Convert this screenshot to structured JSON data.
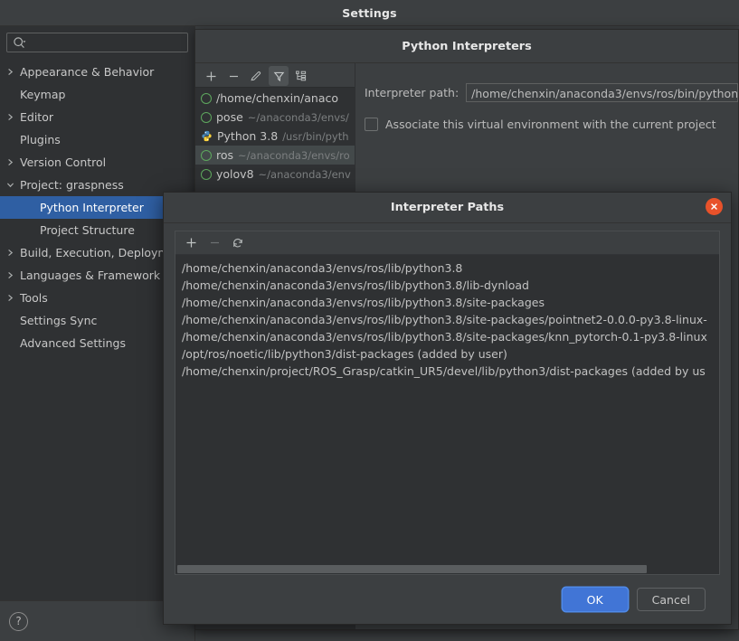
{
  "settings": {
    "title": "Settings",
    "search": {
      "value": "",
      "placeholder": ""
    },
    "tree": [
      {
        "label": "Appearance & Behavior",
        "arrow": "chevron-right",
        "indent": 0,
        "selected": false
      },
      {
        "label": "Keymap",
        "arrow": "none",
        "indent": 0,
        "selected": false
      },
      {
        "label": "Editor",
        "arrow": "chevron-right",
        "indent": 0,
        "selected": false
      },
      {
        "label": "Plugins",
        "arrow": "none",
        "indent": 0,
        "selected": false
      },
      {
        "label": "Version Control",
        "arrow": "chevron-right",
        "indent": 0,
        "selected": false
      },
      {
        "label": "Project: graspness",
        "arrow": "chevron-down",
        "indent": 0,
        "selected": false
      },
      {
        "label": "Python Interpreter",
        "arrow": "none",
        "indent": 1,
        "selected": true
      },
      {
        "label": "Project Structure",
        "arrow": "none",
        "indent": 1,
        "selected": false
      },
      {
        "label": "Build, Execution, Deployn",
        "arrow": "chevron-right",
        "indent": 0,
        "selected": false
      },
      {
        "label": "Languages & Framework",
        "arrow": "chevron-right",
        "indent": 0,
        "selected": false
      },
      {
        "label": "Tools",
        "arrow": "chevron-right",
        "indent": 0,
        "selected": false
      },
      {
        "label": "Settings Sync",
        "arrow": "none",
        "indent": 0,
        "selected": false
      },
      {
        "label": "Advanced Settings",
        "arrow": "none",
        "indent": 0,
        "selected": false
      }
    ],
    "help_glyph": "?"
  },
  "interpreters": {
    "title": "Python Interpreters",
    "toolbar": [
      {
        "name": "add-interpreter-button",
        "icon": "plus-icon",
        "active": false
      },
      {
        "name": "remove-interpreter-button",
        "icon": "minus-icon",
        "active": false
      },
      {
        "name": "edit-interpreter-button",
        "icon": "pencil-icon",
        "active": false
      },
      {
        "name": "filter-interpreters-button",
        "icon": "filter-icon",
        "active": true
      },
      {
        "name": "group-interpreters-button",
        "icon": "tree-structure-icon",
        "active": false
      }
    ],
    "list": [
      {
        "name": "/home/chenxin/anaco",
        "sub": "",
        "icon": "conda-env-icon",
        "selected": false
      },
      {
        "name": "pose",
        "sub": "~/anaconda3/envs/",
        "icon": "conda-env-icon",
        "selected": false
      },
      {
        "name": "Python 3.8",
        "sub": "/usr/bin/pyth",
        "icon": "python-icon",
        "selected": false
      },
      {
        "name": "ros",
        "sub": "~/anaconda3/envs/ro",
        "icon": "conda-env-icon",
        "selected": true
      },
      {
        "name": "yolov8",
        "sub": "~/anaconda3/env",
        "icon": "conda-env-icon",
        "selected": false
      }
    ],
    "detail": {
      "path_label": "Interpreter path:",
      "path_label_mnemonic": "I",
      "path_value": "/home/chenxin/anaconda3/envs/ros/bin/python",
      "associate_checkbox_label": "Associate this virtual environment with the current project",
      "associate_checked": false
    }
  },
  "paths_dialog": {
    "title": "Interpreter Paths",
    "close_icon": "close-icon",
    "toolbar": [
      {
        "name": "add-path-button",
        "icon": "plus-icon",
        "enabled": true
      },
      {
        "name": "remove-path-button",
        "icon": "minus-icon",
        "enabled": false
      },
      {
        "name": "reload-paths-button",
        "icon": "refresh-icon",
        "enabled": true
      }
    ],
    "paths": [
      "/home/chenxin/anaconda3/envs/ros/lib/python3.8",
      "/home/chenxin/anaconda3/envs/ros/lib/python3.8/lib-dynload",
      "/home/chenxin/anaconda3/envs/ros/lib/python3.8/site-packages",
      "/home/chenxin/anaconda3/envs/ros/lib/python3.8/site-packages/pointnet2-0.0.0-py3.8-linux-",
      "/home/chenxin/anaconda3/envs/ros/lib/python3.8/site-packages/knn_pytorch-0.1-py3.8-linux",
      "/opt/ros/noetic/lib/python3/dist-packages  (added by user)",
      "/home/chenxin/project/ROS_Grasp/catkin_UR5/devel/lib/python3/dist-packages  (added by us"
    ],
    "ok_label": "OK",
    "cancel_label": "Cancel"
  },
  "colors": {
    "accent_blue": "#4175d6",
    "selection_blue": "#2f5fa3",
    "close_red": "#e8522a",
    "conda_green": "#5ea85e",
    "window_bg": "#3c3f41",
    "list_bg": "#2f3133"
  }
}
